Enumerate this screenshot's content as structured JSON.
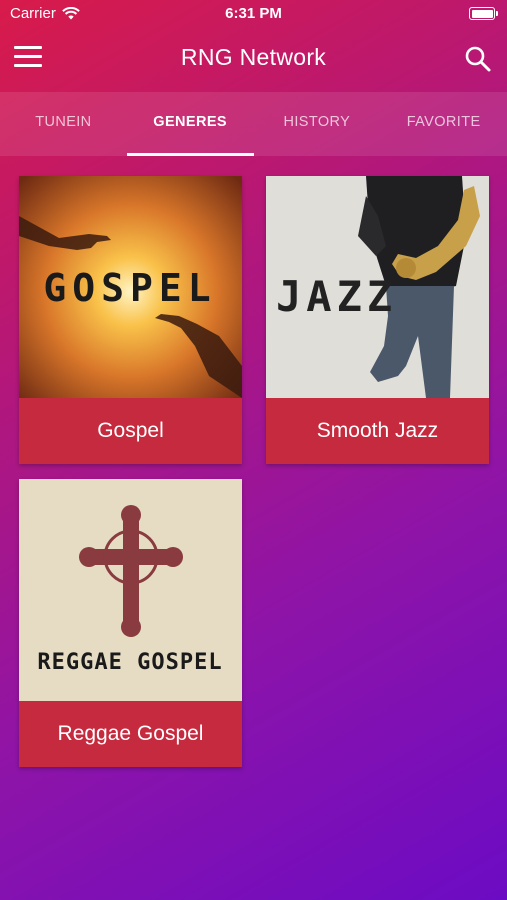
{
  "status": {
    "carrier": "Carrier",
    "time": "6:31 PM"
  },
  "header": {
    "title": "RNG Network"
  },
  "tabs": [
    {
      "label": "TUNEIN"
    },
    {
      "label": "GENERES",
      "active": true
    },
    {
      "label": "HISTORY"
    },
    {
      "label": "FAVORITE"
    }
  ],
  "genres": [
    {
      "label": "Gospel",
      "art_text": "GOSPEL"
    },
    {
      "label": "Smooth Jazz",
      "art_text": "JAZZ"
    },
    {
      "label": "Reggae Gospel",
      "art_text": "REGGAE GOSPEL"
    }
  ],
  "colors": {
    "card_label_bg": "#c62a3e",
    "gradient_start": "#d81b4a",
    "gradient_end": "#6c0bc4"
  }
}
